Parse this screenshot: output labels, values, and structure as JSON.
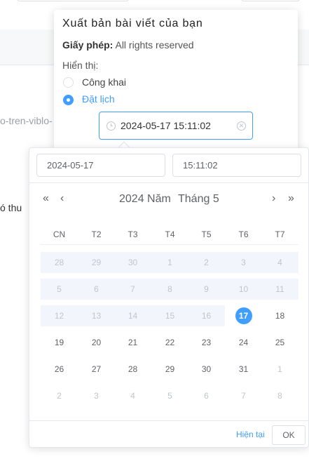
{
  "background": {
    "slug_fragment": "o-tren-viblo-",
    "text_fragment": "ó thu"
  },
  "publish": {
    "title": "Xuất bản bài viết của bạn",
    "license_label": "Giấy phép:",
    "license_value": "All rights reserved",
    "visibility_label": "Hiển thị:",
    "options": [
      {
        "label": "Công khai",
        "checked": false
      },
      {
        "label": "Đặt lịch",
        "checked": true
      }
    ],
    "schedule_value": "2024-05-17 15:11:02",
    "schedule_icon": "clock-icon",
    "clear_icon": "circle-close-icon"
  },
  "picker": {
    "date_input": "2024-05-17",
    "time_input": "15:11:02",
    "nav": {
      "prev_year": "«",
      "prev_month": "‹",
      "next_month": "›",
      "next_year": "»"
    },
    "header_year": "2024 Năm",
    "header_month": "Tháng 5",
    "weekdays": [
      "CN",
      "T2",
      "T3",
      "T4",
      "T5",
      "T6",
      "T7"
    ],
    "weeks": [
      [
        "28",
        "29",
        "30",
        "1",
        "2",
        "3",
        "4"
      ],
      [
        "5",
        "6",
        "7",
        "8",
        "9",
        "10",
        "11"
      ],
      [
        "12",
        "13",
        "14",
        "15",
        "16",
        "17",
        "18"
      ],
      [
        "19",
        "20",
        "21",
        "22",
        "23",
        "24",
        "25"
      ],
      [
        "26",
        "27",
        "28",
        "29",
        "30",
        "31",
        "1"
      ],
      [
        "2",
        "3",
        "4",
        "5",
        "6",
        "7",
        "8"
      ]
    ],
    "selected_date": "2024-05-17",
    "now_label": "Hiện tại",
    "ok_label": "OK"
  },
  "colors": {
    "accent": "#409eff",
    "disabled_bg": "#f2f6fc",
    "muted_text": "#c0c4cc"
  }
}
